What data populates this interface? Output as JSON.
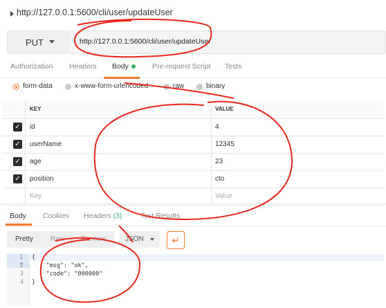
{
  "request": {
    "title": "http://127.0.0.1:5600/cli/user/updateUser",
    "method": "PUT",
    "url": "http://127.0.0.1:5600/cli/user/updateUser"
  },
  "request_tabs": [
    "Authorization",
    "Headers",
    "Body",
    "Pre-request Script",
    "Tests"
  ],
  "active_request_tab": "Body",
  "body_types": [
    "form-data",
    "x-www-form-urlencoded",
    "raw",
    "binary"
  ],
  "selected_body_type": "form-data",
  "params_table": {
    "headers": [
      "KEY",
      "VALUE"
    ],
    "rows": [
      {
        "key": "id",
        "value": "4"
      },
      {
        "key": "userName",
        "value": "12345"
      },
      {
        "key": "age",
        "value": "23"
      },
      {
        "key": "position",
        "value": "cto"
      }
    ],
    "placeholder": {
      "key": "Key",
      "value": "Value"
    }
  },
  "response_tabs": [
    "Body",
    "Cookies",
    "Headers",
    "Test Results"
  ],
  "response_headers_count": "(3)",
  "active_response_tab": "Body",
  "view_modes": [
    "Pretty",
    "Raw",
    "Preview"
  ],
  "format": "JSON",
  "response_body": {
    "line_numbers": [
      "1",
      "2",
      "3",
      "4"
    ],
    "lines": [
      "{",
      "    \"msg\": \"ok\",",
      "    \"code\": \"000000\"",
      "}"
    ]
  },
  "colors": {
    "accent": "#f4792b",
    "annotation": "#e8261c",
    "dot": "#39b35b"
  },
  "icons": {
    "title_expand": "caret-right-icon",
    "method_dropdown": "chevron-down-icon",
    "wrap": "wrap-lines-icon",
    "checkbox": "checkbox-checked-icon"
  }
}
